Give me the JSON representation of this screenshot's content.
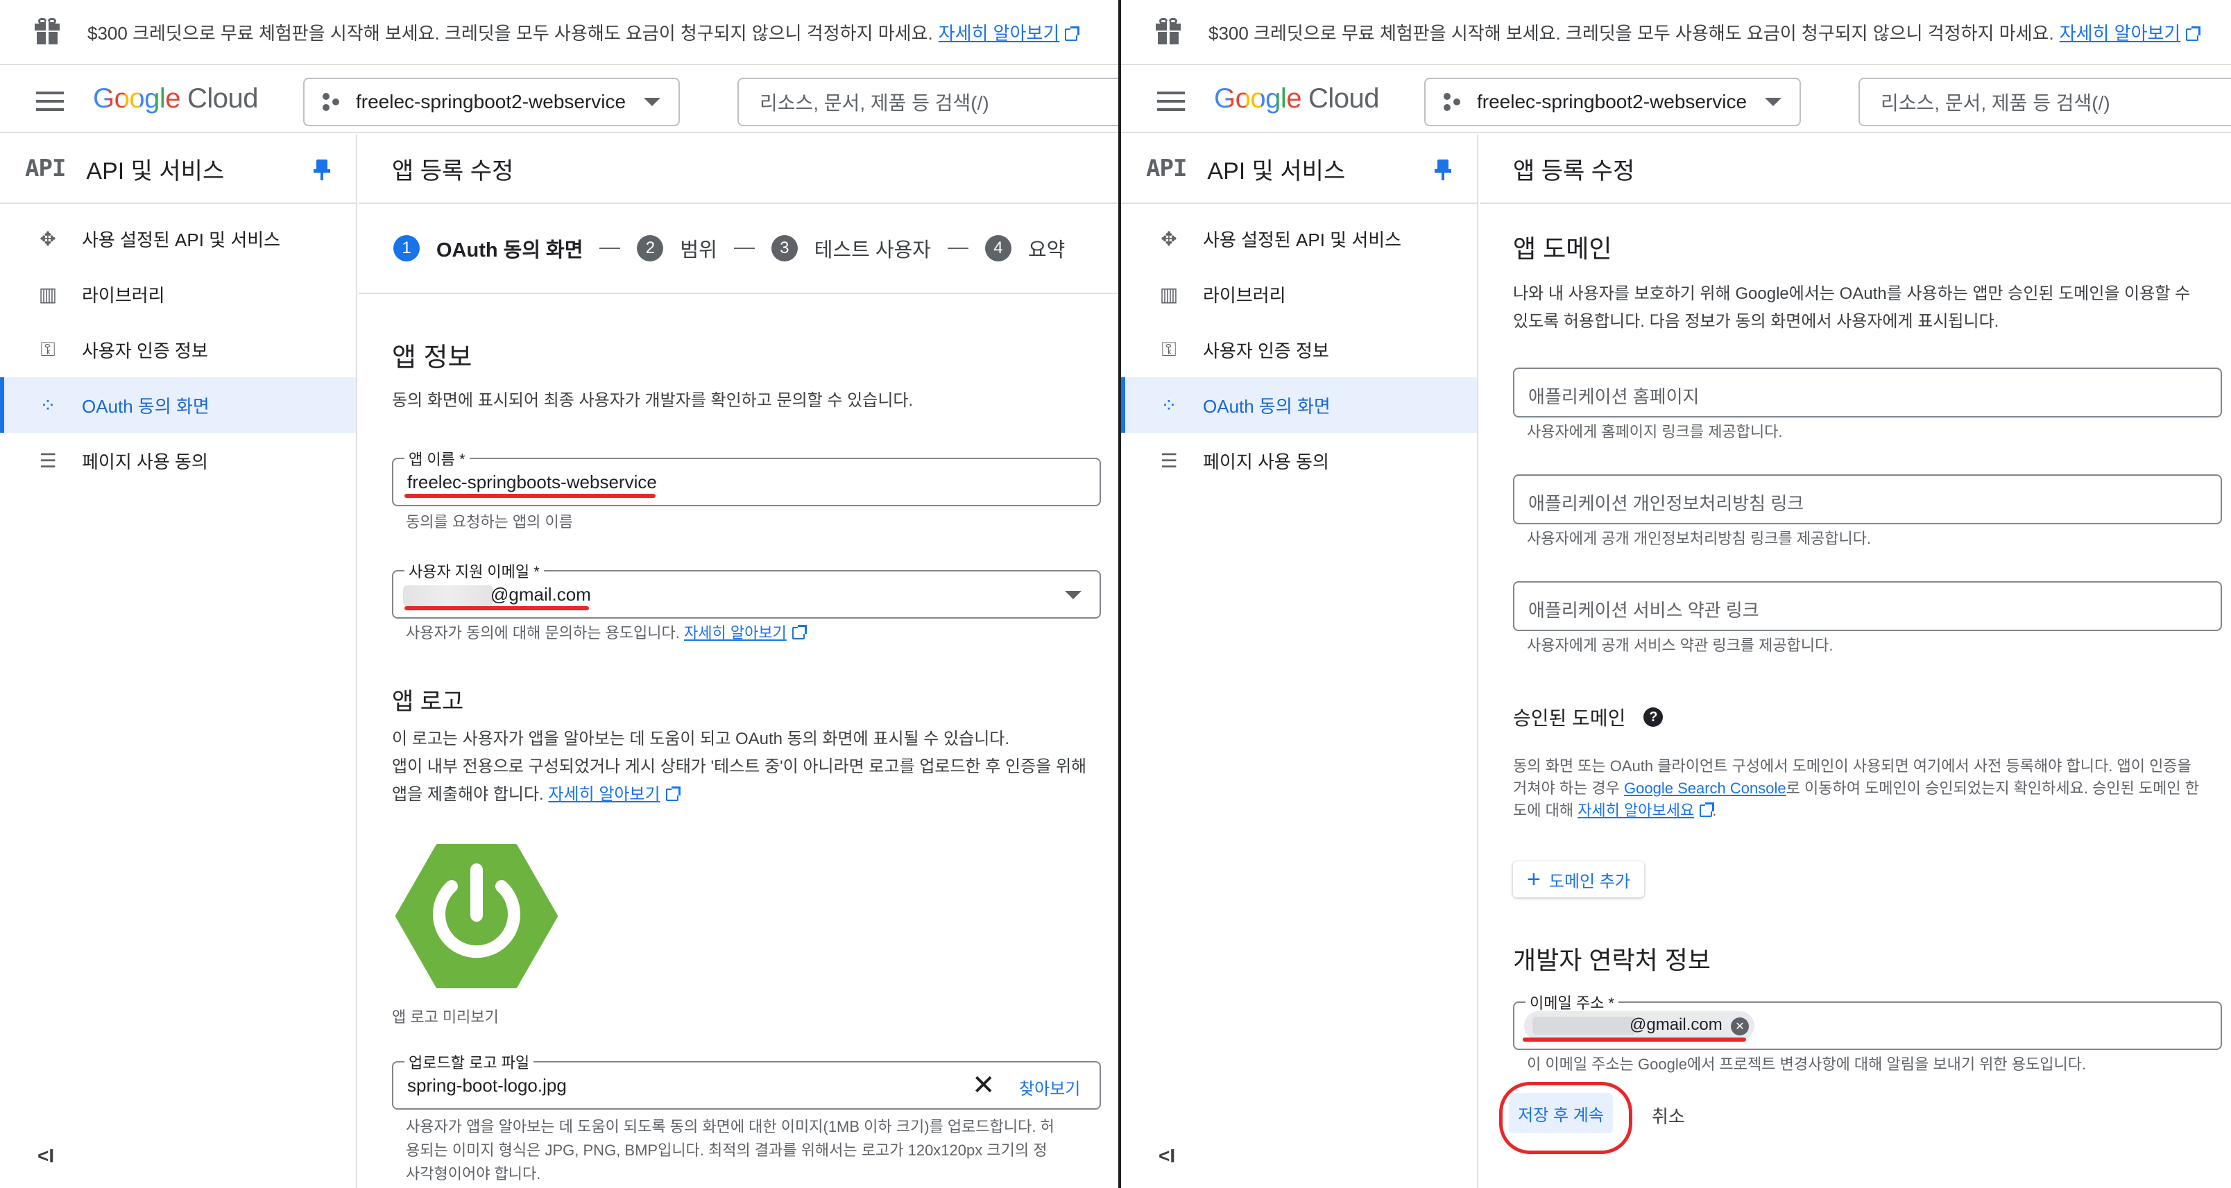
{
  "banner": {
    "text": "$300 크레딧으로 무료 체험판을 시작해 보세요. 크레딧을 모두 사용해도 요금이 청구되지 않으니 걱정하지 마세요.",
    "link": "자세히 알아보기"
  },
  "header": {
    "logo_google": "Google",
    "logo_cloud": "Cloud",
    "project": "freelec-springboot2-webservice",
    "search_placeholder": "리소스, 문서, 제품 등 검색(/)"
  },
  "sidebar": {
    "title": "API 및 서비스",
    "api_mark": "API",
    "items": [
      {
        "label": "사용 설정된 API 및 서비스",
        "icon": "api-hub-icon"
      },
      {
        "label": "라이브러리",
        "icon": "library-icon"
      },
      {
        "label": "사용자 인증 정보",
        "icon": "key-icon"
      },
      {
        "label": "OAuth 동의 화면",
        "icon": "oauth-consent-icon",
        "active": true
      },
      {
        "label": "페이지 사용 동의",
        "icon": "settings-list-icon"
      }
    ],
    "collapse": "<I"
  },
  "page_title": "앱 등록 수정",
  "stepper": [
    {
      "num": "1",
      "label": "OAuth 동의 화면",
      "active": true
    },
    {
      "num": "2",
      "label": "범위"
    },
    {
      "num": "3",
      "label": "테스트 사용자"
    },
    {
      "num": "4",
      "label": "요약"
    }
  ],
  "left": {
    "app_info_title": "앱 정보",
    "app_info_desc": "동의 화면에 표시되어 최종 사용자가 개발자를 확인하고 문의할 수 있습니다.",
    "app_name_label": "앱 이름 *",
    "app_name_value": "freelec-springboots-webservice",
    "app_name_help": "동의를 요청하는 앱의 이름",
    "support_email_label": "사용자 지원 이메일 *",
    "support_email_value": "@gmail.com",
    "support_email_help": "사용자가 동의에 대해 문의하는 용도입니다.",
    "support_email_link": "자세히 알아보기",
    "logo_title": "앱 로고",
    "logo_desc1": "이 로고는 사용자가 앱을 알아보는 데 도움이 되고 OAuth 동의 화면에 표시될 수 있습니다.",
    "logo_desc2": "앱이 내부 전용으로 구성되었거나 게시 상태가 '테스트 중'이 아니라면 로고를 업로드한 후 인증을 위해",
    "logo_desc3": "앱을 제출해야 합니다.",
    "logo_link": "자세히 알아보기",
    "logo_preview": "앱 로고 미리보기",
    "upload_label": "업로드할 로고 파일",
    "upload_value": "spring-boot-logo.jpg",
    "browse": "찾아보기",
    "upload_help1": "사용자가 앱을 알아보는 데 도움이 되도록 동의 화면에 대한 이미지(1MB 이하 크기)를 업로드합니다. 허",
    "upload_help2": "용되는 이미지 형식은 JPG, PNG, BMP입니다. 최적의 결과를 위해서는 로고가 120x120px 크기의 정",
    "upload_help3": "사각형이어야 합니다."
  },
  "right": {
    "domain_title": "앱 도메인",
    "domain_desc1": "나와 내 사용자를 보호하기 위해 Google에서는 OAuth를 사용하는 앱만 승인된 도메인을 이용할 수",
    "domain_desc2": "있도록 허용합니다. 다음 정보가 동의 화면에서 사용자에게 표시됩니다.",
    "homepage_ph": "애플리케이션 홈페이지",
    "homepage_help": "사용자에게 홈페이지 링크를 제공합니다.",
    "privacy_ph": "애플리케이션 개인정보처리방침 링크",
    "privacy_help": "사용자에게 공개 개인정보처리방침 링크를 제공합니다.",
    "tos_ph": "애플리케이션 서비스 약관 링크",
    "tos_help": "사용자에게 공개 서비스 약관 링크를 제공합니다.",
    "auth_domain_title": "승인된 도메인",
    "auth_desc1": "동의 화면 또는 OAuth 클라이언트 구성에서 도메인이 사용되면 여기에서 사전 등록해야 합니다. 앱이 인증을",
    "auth_desc2a": "거쳐야 하는 경우 ",
    "auth_desc2_link": "Google Search Console",
    "auth_desc2b": "로 이동하여 도메인이 승인되었는지 확인하세요. 승인된 도메인 한",
    "auth_desc3a": "도에 대해 ",
    "auth_desc3_link": "자세히 알아보세요",
    "auth_desc3b": ".",
    "add_domain": "도메인 추가",
    "dev_title": "개발자 연락처 정보",
    "email_label": "이메일 주소 *",
    "email_chip": "@gmail.com",
    "email_help": "이 이메일 주소는 Google에서 프로젝트 변경사항에 대해 알림을 보내기 위한 용도입니다.",
    "save": "저장 후 계속",
    "cancel": "취소"
  },
  "colors": {
    "accent": "#1a73e8",
    "underline_red": "#e8272a",
    "spring_green": "#6db33f"
  }
}
